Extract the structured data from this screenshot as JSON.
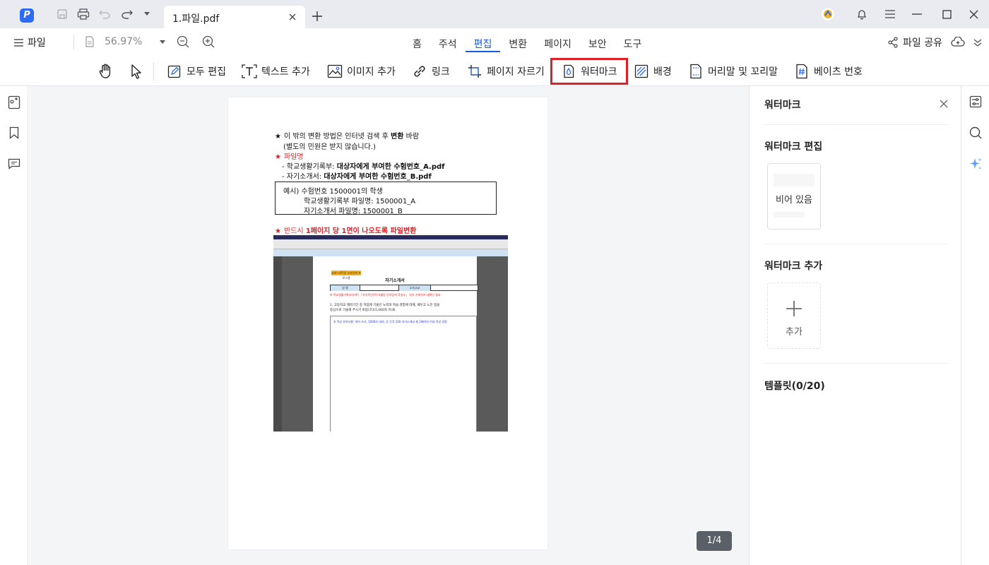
{
  "titlebar": {
    "tab_title": "1.파일.pdf"
  },
  "menubar": {
    "file_label": "파일",
    "zoom_value": "56.97%",
    "tabs": [
      {
        "label": "홈"
      },
      {
        "label": "주석"
      },
      {
        "label": "편집"
      },
      {
        "label": "변환"
      },
      {
        "label": "페이지"
      },
      {
        "label": "보안"
      },
      {
        "label": "도구"
      }
    ],
    "active_tab": "편집",
    "share_label": "파일 공유"
  },
  "toolbar": {
    "edit_all": "모두 편집",
    "add_text": "텍스트 추가",
    "add_image": "이미지 추가",
    "link": "링크",
    "crop_page": "페이지 자르기",
    "watermark": "워터마크",
    "background": "배경",
    "header_footer": "머리말 및 꼬리말",
    "bates": "베이츠 번호"
  },
  "document": {
    "line1_a": "이 밖의 변환 방법은 인터넷 검색 후 ",
    "line1_b": "변환",
    "line1_c": " 바람",
    "line2": "(별도의 민원은 받지 않습니다.)",
    "line3": "파일명",
    "line4_a": "- 학교생활기록부: ",
    "line4_b": "대상자에게 부여한 수험번호_A.pdf",
    "line5_a": "- 자기소개서: ",
    "line5_b": "대상자에게 부여한 수험번호_B.pdf",
    "example1": "예시) 수험번호 1500001의 학생",
    "example2": "학교생활기록부 파일명: 1500001_A",
    "example3": "자기소개서 파일명: 1500001_B",
    "line6_a": "반드시 ",
    "line6_b": "1페이지 당 1면이 나오도록 파일변환",
    "shot_badge": "with 대학생 교과연계 프로그램",
    "shot_title": "자기소개서",
    "shot_cell1": "성   명",
    "shot_cell2": "소속고교",
    "shot_red": "※ 학교생활기록부(부록) 「자유학년(학기)활동·진로탐색 학생부」 지속 기록하여 재확인 필요",
    "shot_q1": "1. 고등학교 재학기간 중 학업에 기울인 노력과 학습 경험에 대해, 배우고 느낀 점을",
    "shot_q2": "   중심으로 기술해 주시기 바랍니다(1,000자 이내).",
    "shot_blue": "※ 작성 유의사항: 띄어 쓰기, 1000자 내외, 공 간격 100 자기소개서 총 2페이지 이내 작성 권장"
  },
  "page_indicator": "1/4",
  "panel": {
    "title": "워터마크",
    "edit_section": "워터마크 편집",
    "empty_label": "비어 있음",
    "add_section": "워터마크 추가",
    "add_label": "추가",
    "template_section": "템플릿(0/20)"
  },
  "colors": {
    "accent": "#1a57e8",
    "highlight_border": "#e01e24",
    "doc_red": "#e01e24"
  }
}
